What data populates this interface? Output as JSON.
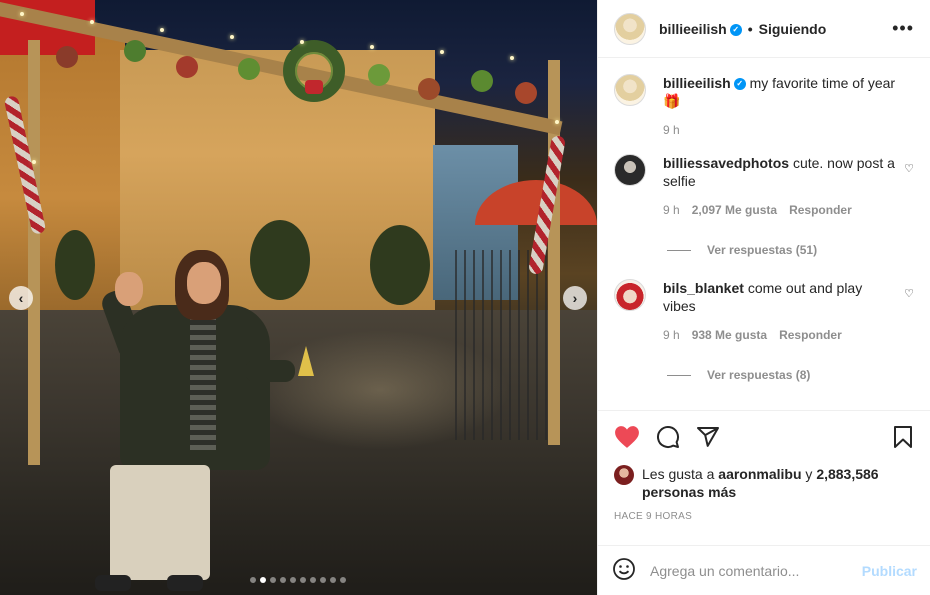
{
  "header": {
    "username": "billieeilish",
    "separator": "•",
    "follow_status": "Siguiendo",
    "more_label": "•••"
  },
  "caption": {
    "username": "billieeilish",
    "text": "my favorite time of year",
    "emoji": "🎁",
    "time": "9 h"
  },
  "comments": [
    {
      "username": "billiessavedphotos",
      "text": "cute. now post a selfie",
      "time": "9 h",
      "likes": "2,097 Me gusta",
      "reply": "Responder",
      "view_replies": "Ver respuestas (51)"
    },
    {
      "username": "bils_blanket",
      "text": "come out and play vibes",
      "time": "9 h",
      "likes": "938 Me gusta",
      "reply": "Responder",
      "view_replies": "Ver respuestas (8)"
    }
  ],
  "likes": {
    "prefix": "Les gusta a",
    "user": "aaronmalibu",
    "joiner": "y",
    "others": "2,883,586 personas más"
  },
  "timestamp": "HACE 9 HORAS",
  "composer": {
    "placeholder": "Agrega un comentario...",
    "post_label": "Publicar"
  },
  "carousel": {
    "prev_icon": "‹",
    "next_icon": "›",
    "total_slides": 10,
    "active_index": 1
  },
  "colors": {
    "like_red": "#ed4956",
    "verified_blue": "#0095f6",
    "post_disabled": "#b3dbff"
  }
}
